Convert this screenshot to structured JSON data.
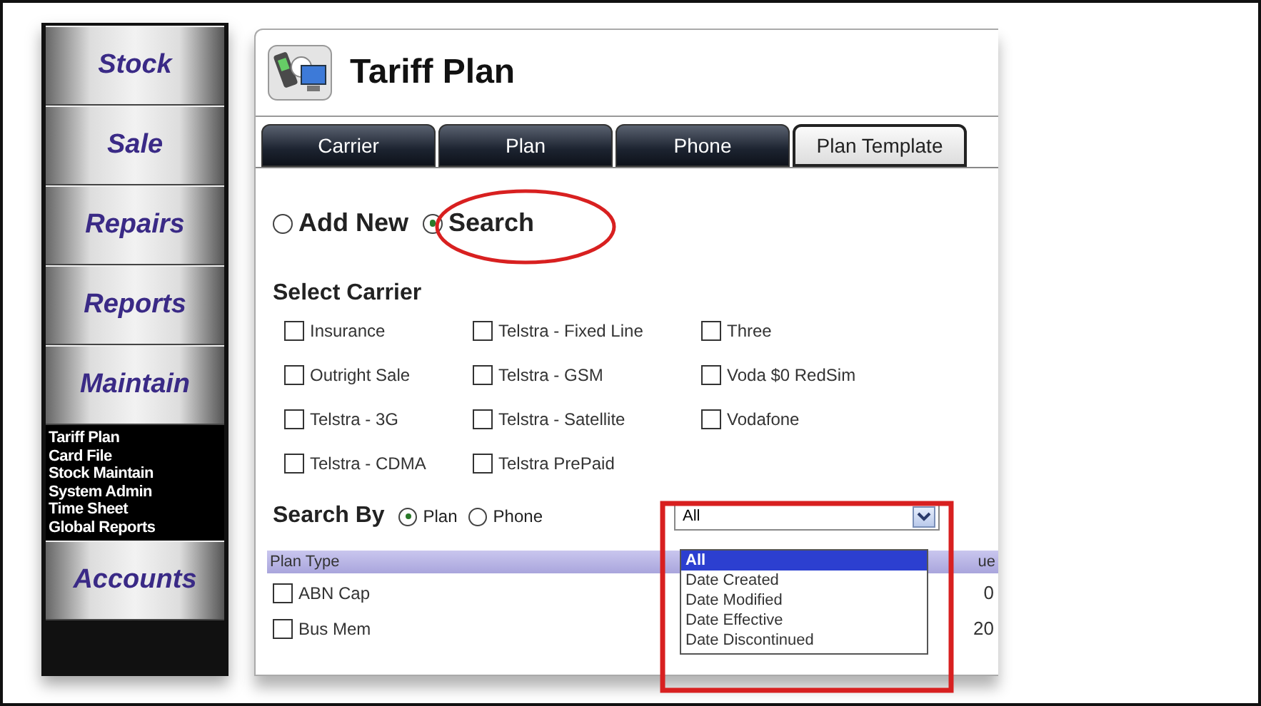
{
  "sidebar": {
    "items": [
      {
        "label": "Stock"
      },
      {
        "label": "Sale"
      },
      {
        "label": "Repairs"
      },
      {
        "label": "Reports"
      },
      {
        "label": "Maintain",
        "children": [
          {
            "label": "Tariff Plan"
          },
          {
            "label": "Card File"
          },
          {
            "label": "Stock Maintain"
          },
          {
            "label": "System Admin"
          },
          {
            "label": "Time Sheet"
          },
          {
            "label": "Global Reports"
          }
        ]
      },
      {
        "label": "Accounts"
      }
    ]
  },
  "page": {
    "title": "Tariff Plan"
  },
  "tabs": [
    {
      "label": "Carrier",
      "selected": false
    },
    {
      "label": "Plan",
      "selected": false
    },
    {
      "label": "Phone",
      "selected": false
    },
    {
      "label": "Plan Template",
      "selected": true
    }
  ],
  "mode": [
    {
      "label": "Add New",
      "selected": false
    },
    {
      "label": "Search",
      "selected": true
    }
  ],
  "carrier": {
    "heading": "Select Carrier",
    "options": [
      {
        "label": "Insurance",
        "checked": false
      },
      {
        "label": "Telstra - Fixed Line",
        "checked": false
      },
      {
        "label": "Three",
        "checked": false
      },
      {
        "label": "Outright Sale",
        "checked": false
      },
      {
        "label": "Telstra - GSM",
        "checked": false
      },
      {
        "label": "Voda $0 RedSim",
        "checked": false
      },
      {
        "label": "Telstra - 3G",
        "checked": false
      },
      {
        "label": "Telstra - Satellite",
        "checked": false
      },
      {
        "label": "Vodafone",
        "checked": false
      },
      {
        "label": "Telstra - CDMA",
        "checked": false
      },
      {
        "label": "Telstra PrePaid",
        "checked": false
      }
    ]
  },
  "search_by": {
    "label": "Search By",
    "options": [
      {
        "label": "Plan",
        "selected": true
      },
      {
        "label": "Phone",
        "selected": false
      }
    ]
  },
  "date_filter": {
    "value": "All",
    "options": [
      {
        "label": "All",
        "selected": true
      },
      {
        "label": "Date Created",
        "selected": false
      },
      {
        "label": "Date Modified",
        "selected": false
      },
      {
        "label": "Date Effective",
        "selected": false
      },
      {
        "label": "Date Discontinued",
        "selected": false
      }
    ]
  },
  "table": {
    "columns": [
      "Plan Type",
      "ue"
    ],
    "rows": [
      {
        "plan_type": "ABN Cap",
        "checked": false,
        "column_2": "0"
      },
      {
        "plan_type": "Bus Mem",
        "checked": false,
        "column_2": "20"
      }
    ]
  }
}
